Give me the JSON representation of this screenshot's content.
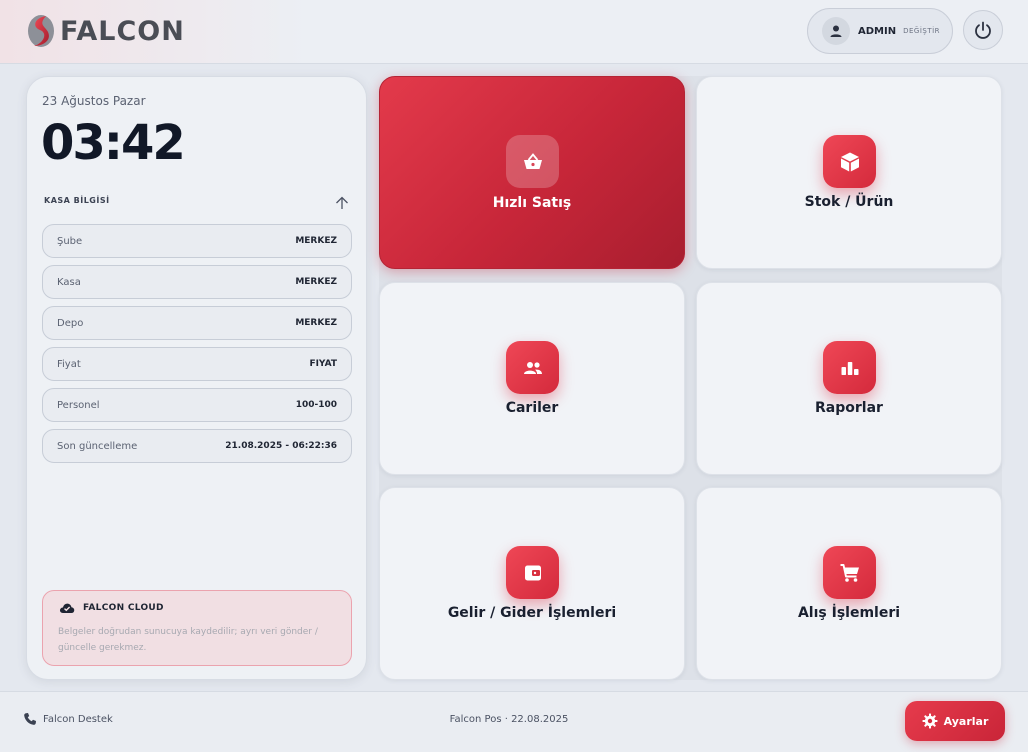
{
  "header": {
    "logo_text": "FALCON",
    "user_name": "ADMIN",
    "user_switch": "DEĞİŞTİR"
  },
  "left_panel": {
    "date": "23 Ağustos Pazar",
    "clock": "03:42",
    "kasa_title": "KASA BİLGİSİ",
    "info_rows": [
      {
        "label": "Şube",
        "value": "MERKEZ"
      },
      {
        "label": "Kasa",
        "value": "MERKEZ"
      },
      {
        "label": "Depo",
        "value": "MERKEZ"
      },
      {
        "label": "Fiyat",
        "value": "FIYAT"
      },
      {
        "label": "Personel",
        "value": "100-100"
      },
      {
        "label": "Son güncelleme",
        "value": "21.08.2025 - 06:22:36"
      }
    ],
    "cloud": {
      "title": "FALCON CLOUD",
      "text": "Belgeler doğrudan sunucuya kaydedilir; ayrı veri gönder / güncelle gerekmez."
    }
  },
  "tiles": [
    {
      "label": "Hızlı Satış",
      "icon": "basket-icon",
      "active": true
    },
    {
      "label": "Stok / Ürün",
      "icon": "box-icon",
      "active": false
    },
    {
      "label": "Cariler",
      "icon": "people-icon",
      "active": false
    },
    {
      "label": "Raporlar",
      "icon": "bar-chart-icon",
      "active": false
    },
    {
      "label": "Gelir / Gider İşlemleri",
      "icon": "wallet-icon",
      "active": false
    },
    {
      "label": "Alış İşlemleri",
      "icon": "cart-icon",
      "active": false
    }
  ],
  "footer": {
    "support": "Falcon Destek",
    "center": "Falcon Pos · 22.08.2025",
    "settings_label": "Ayarlar"
  },
  "colors": {
    "accent": "#d42a3c",
    "background": "#e4e8ef"
  }
}
